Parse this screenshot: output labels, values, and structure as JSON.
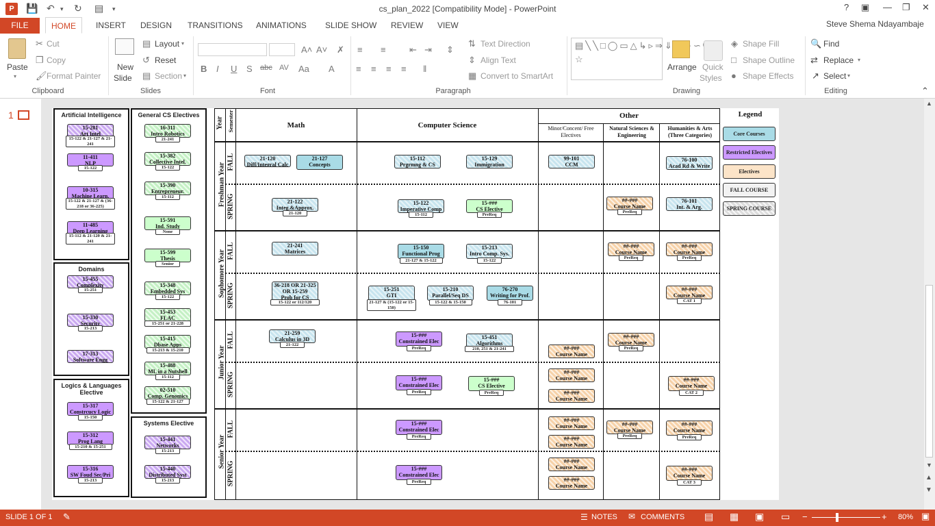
{
  "window": {
    "title": "cs_plan_2022 [Compatibility Mode] - PowerPoint",
    "help": "?",
    "user": "Steve Shema Ndayambaje"
  },
  "tabs": [
    {
      "label": "FILE"
    },
    {
      "label": "HOME"
    },
    {
      "label": "INSERT"
    },
    {
      "label": "DESIGN"
    },
    {
      "label": "TRANSITIONS"
    },
    {
      "label": "ANIMATIONS"
    },
    {
      "label": "SLIDE SHOW"
    },
    {
      "label": "REVIEW"
    },
    {
      "label": "VIEW"
    }
  ],
  "ribbon": {
    "clipboard": {
      "paste": "Paste",
      "cut": "Cut",
      "copy": "Copy",
      "format_painter": "Format Painter",
      "group": "Clipboard"
    },
    "slides": {
      "new_slide_1": "New",
      "new_slide_2": "Slide",
      "layout": "Layout",
      "reset": "Reset",
      "section": "Section",
      "group": "Slides"
    },
    "font": {
      "group": "Font"
    },
    "paragraph": {
      "text_direction": "Text Direction",
      "align_text": "Align Text",
      "smartart": "Convert to SmartArt",
      "group": "Paragraph"
    },
    "drawing": {
      "arrange": "Arrange",
      "quick_styles_1": "Quick",
      "quick_styles_2": "Styles",
      "shape_fill": "Shape Fill",
      "shape_outline": "Shape Outline",
      "shape_effects": "Shape Effects",
      "group": "Drawing"
    },
    "editing": {
      "find": "Find",
      "replace": "Replace",
      "select": "Select",
      "group": "Editing"
    }
  },
  "thumb": {
    "number": "1"
  },
  "status": {
    "slide": "SLIDE 1 OF 1",
    "notes": "NOTES",
    "comments": "COMMENTS",
    "zoom": "80%"
  },
  "slide": {
    "left_panels": [
      {
        "title": "Artificial Intelligence",
        "courses": [
          {
            "num": "15-281",
            "name": "Art Intel",
            "prereq": "15-122 & 21-127 & 21-241"
          },
          {
            "num": "11-411",
            "name": "NLP",
            "prereq": "15-122"
          },
          {
            "num": "10-315",
            "name": "Machine Learn.",
            "prereq": "15-122 & 21-127 & (36-218 or 36-225)"
          },
          {
            "num": "11-485",
            "name": "Deep Learning",
            "prereq": "15-112 & 21-120 & 21-241"
          }
        ]
      },
      {
        "title": "Domains",
        "courses": [
          {
            "num": "15-455",
            "name": "Complexity",
            "prereq": "15-251"
          },
          {
            "num": "15-330",
            "name": "Security",
            "prereq": "15-213"
          },
          {
            "num": "17-313",
            "name": "Software Engg",
            "prereq": ""
          }
        ]
      },
      {
        "title": "Logics & Languages Elective",
        "courses": [
          {
            "num": "15-317",
            "name": "Constrcucy Logic",
            "prereq": "15-150"
          },
          {
            "num": "15-312",
            "name": "Prog Lang",
            "prereq": "15-210 & 15-251"
          },
          {
            "num": "15-316",
            "name": "SW Foud Sec/Pri",
            "prereq": "15-213"
          }
        ]
      },
      {
        "title": "General CS Electives",
        "courses": [
          {
            "num": "16-311",
            "name": "Intro Robotics",
            "prereq": "21-241"
          },
          {
            "num": "15-382",
            "name": "Collective Intel.",
            "prereq": "15-122"
          },
          {
            "num": "15-390",
            "name": "Entrepreneur.",
            "prereq": "15-112"
          },
          {
            "num": "15-591",
            "name": "Ind. Study",
            "prereq": "None"
          },
          {
            "num": "15-599",
            "name": "Thesis",
            "prereq": "Senior"
          },
          {
            "num": "15-348",
            "name": "Embedded Sys",
            "prereq": "15-122"
          },
          {
            "num": "15-453",
            "name": "FLAC",
            "prereq": "15-251 or 21-228"
          },
          {
            "num": "15-415",
            "name": "Dbase Apps",
            "prereq": "15-213 & 15-210"
          },
          {
            "num": "15-488",
            "name": "ML in a Nutshell",
            "prereq": "15-112"
          },
          {
            "num": "02-510",
            "name": "Comp. Genomics",
            "prereq": "15-122 & 21-127"
          }
        ]
      },
      {
        "title": "Systems Elective",
        "courses": [
          {
            "num": "15-441",
            "name": "Networks",
            "prereq": "15-213"
          },
          {
            "num": "15-440",
            "name": "Distributed Syst",
            "prereq": "15-213"
          }
        ]
      }
    ],
    "headers": {
      "year": "Year",
      "semester": "Semester",
      "math": "Math",
      "cs": "Computer Science",
      "other": "Other",
      "minor": "Minor/Concent/ Free Electives",
      "natsci": "Natural Sciences & Engineering",
      "hum": "Humanities & Arts (Three Categories)"
    },
    "years": [
      "Freshman Year",
      "Sophomore Year",
      "Junior Year",
      "Senior Year"
    ],
    "sems": {
      "fall": "FALL",
      "spring": "SPRING"
    },
    "grid": [
      {
        "num": "21-120",
        "name": "Diff/Integral Calc",
        "prereq": ""
      },
      {
        "num": "21-127",
        "name": "Concepts",
        "prereq": ""
      },
      {
        "num": "15-112",
        "name": "Prgrmng & CS",
        "prereq": ""
      },
      {
        "num": "15-129",
        "name": "Immigration",
        "prereq": ""
      },
      {
        "num": "99-101",
        "name": "CCM",
        "prereq": ""
      },
      {
        "num": "76-100",
        "name": "Acad Rd & Write",
        "prereq": ""
      },
      {
        "num": "21-122",
        "name": "Integ.&Approx.",
        "prereq": "21-120"
      },
      {
        "num": "15-122",
        "name": "Imperative Comp",
        "prereq": "15-112"
      },
      {
        "num": "15-###",
        "name": "CS Elective",
        "prereq": "PreReq"
      },
      {
        "num": "##-###",
        "name": "Course Name",
        "prereq": "PreReq"
      },
      {
        "num": "76-101",
        "name": "Int. & Arg.",
        "prereq": ""
      },
      {
        "num": "21-241",
        "name": "Matrices",
        "prereq": ""
      },
      {
        "num": "15-150",
        "name": "Functional Prog",
        "prereq": "21-127 & 15-122"
      },
      {
        "num": "15-213",
        "name": "Intro Comp. Sys.",
        "prereq": "15-122"
      },
      {
        "num": "##-###",
        "name": "Course Name",
        "prereq": "PreReq"
      },
      {
        "num": "##-###",
        "name": "Course Name",
        "prereq": "PreReq"
      },
      {
        "num": "36-218 OR 21-325 OR 15-259",
        "name": "Prob for CS",
        "prereq": "15-122 or 112/120"
      },
      {
        "num": "15-251",
        "name": "GTI",
        "prereq": "21-127 & (15-122 or 15-150)"
      },
      {
        "num": "15-210",
        "name": "Parallel/Seq DS",
        "prereq": "15-122 & 15-150"
      },
      {
        "num": "76-270",
        "name": "Writing for Prof.",
        "prereq": "76-101"
      },
      {
        "num": "##-###",
        "name": "Course Name",
        "prereq": "CAT 1"
      },
      {
        "num": "21-259",
        "name": "Calculus in 3D",
        "prereq": "21-122"
      },
      {
        "num": "15-###",
        "name": "Constrained Elec",
        "prereq": "PreReq"
      },
      {
        "num": "15-451",
        "name": "Algorithms",
        "prereq": "210, 251 & 21-241"
      },
      {
        "num": "##-###",
        "name": "Course Name",
        "prereq": ""
      },
      {
        "num": "##-###",
        "name": "Course Name",
        "prereq": "PreReq"
      },
      {
        "num": "15-###",
        "name": "Constrained Elec",
        "prereq": "PreReq"
      },
      {
        "num": "15-###",
        "name": "CS Elective",
        "prereq": "PreReq"
      },
      {
        "num": "##-###",
        "name": "Course Name",
        "prereq": ""
      },
      {
        "num": "##-###",
        "name": "Course Name",
        "prereq": ""
      },
      {
        "num": "##-###",
        "name": "Course Name",
        "prereq": "CAT 2"
      },
      {
        "num": "15-###",
        "name": "Constrained Elec",
        "prereq": "PreReq"
      },
      {
        "num": "##-###",
        "name": "Course Name",
        "prereq": ""
      },
      {
        "num": "##-###",
        "name": "Course Name",
        "prereq": ""
      },
      {
        "num": "##-###",
        "name": "Course Name",
        "prereq": "PreReq"
      },
      {
        "num": "##-###",
        "name": "Course Name",
        "prereq": "PreReq"
      },
      {
        "num": "15-###",
        "name": "Constrained Elec",
        "prereq": "PreReq"
      },
      {
        "num": "##-###",
        "name": "Course Name",
        "prereq": ""
      },
      {
        "num": "##-###",
        "name": "Course Name",
        "prereq": ""
      },
      {
        "num": "##-###",
        "name": "Course Name",
        "prereq": "CAT 3"
      }
    ],
    "legend": {
      "title": "Legend",
      "items": [
        "Core Courses",
        "Restricted Electives",
        "Electives",
        "FALL COURSE",
        "SPRING COURSE"
      ]
    }
  },
  "colors": {
    "accent": "#d24726",
    "core": "#a9dbe6",
    "restricted": "#cc99ff",
    "elective": "#fce4c8",
    "general": "#ccffcc"
  }
}
